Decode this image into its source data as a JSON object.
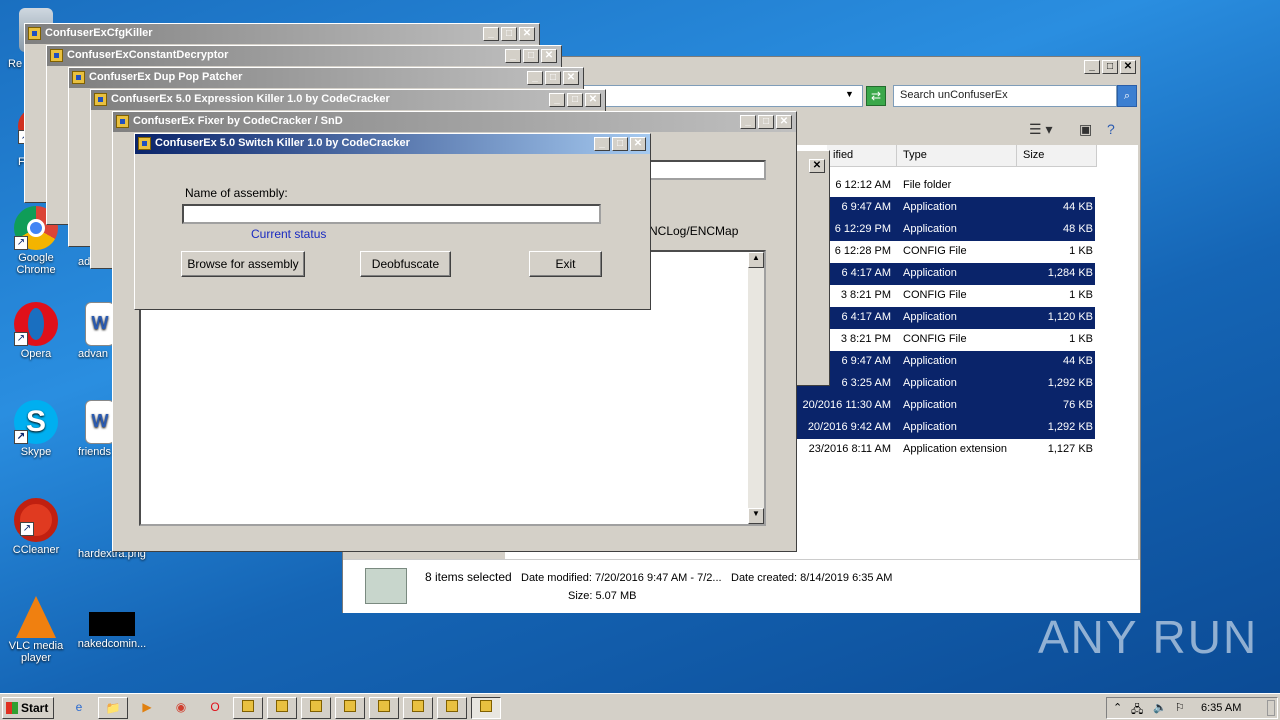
{
  "desktop": {
    "icons": [
      {
        "label": "Re",
        "name": "recycle-bin"
      },
      {
        "label": "F",
        "name": "unknown-app"
      },
      {
        "label": "Google Chrome",
        "name": "google-chrome"
      },
      {
        "label": "Opera",
        "name": "opera"
      },
      {
        "label": "Skype",
        "name": "skype"
      },
      {
        "label": "CCleaner",
        "name": "ccleaner"
      },
      {
        "label": "VLC media player",
        "name": "vlc-media-player"
      },
      {
        "label": "ad",
        "name": "ad-doc"
      },
      {
        "label": "advan",
        "name": "advance-doc"
      },
      {
        "label": "friends",
        "name": "friends-doc"
      },
      {
        "label": "hardextra.png",
        "name": "hardextra-png"
      },
      {
        "label": "nakedcomin...",
        "name": "nakedcoming"
      }
    ]
  },
  "explorer": {
    "search_placeholder": "Search unConfuserEx",
    "columns": [
      "ified",
      "Type",
      "Size"
    ],
    "rows": [
      {
        "date": "6 12:12 AM",
        "type": "File folder",
        "size": "",
        "selected": false
      },
      {
        "date": "6 9:47 AM",
        "type": "Application",
        "size": "44 KB",
        "selected": true
      },
      {
        "date": "6 12:29 PM",
        "type": "Application",
        "size": "48 KB",
        "selected": true
      },
      {
        "date": "6 12:28 PM",
        "type": "CONFIG File",
        "size": "1 KB",
        "selected": false
      },
      {
        "date": "6 4:17 AM",
        "type": "Application",
        "size": "1,284 KB",
        "selected": true
      },
      {
        "date": "3 8:21 PM",
        "type": "CONFIG File",
        "size": "1 KB",
        "selected": false
      },
      {
        "date": "6 4:17 AM",
        "type": "Application",
        "size": "1,120 KB",
        "selected": true
      },
      {
        "date": "3 8:21 PM",
        "type": "CONFIG File",
        "size": "1 KB",
        "selected": false
      },
      {
        "date": "6 9:47 AM",
        "type": "Application",
        "size": "44 KB",
        "selected": true
      },
      {
        "date": "6 3:25 AM",
        "type": "Application",
        "size": "1,292 KB",
        "selected": true
      },
      {
        "date": "20/2016 11:30 AM",
        "type": "Application",
        "size": "76 KB",
        "selected": true
      },
      {
        "date": "20/2016 9:42 AM",
        "type": "Application",
        "size": "1,292 KB",
        "selected": true
      },
      {
        "date": "23/2016 8:11 AM",
        "type": "Application extension",
        "size": "1,127 KB",
        "selected": false
      }
    ],
    "status": {
      "selected": "8 items selected",
      "modified": "Date modified: 7/20/2016 9:47 AM - 7/2...",
      "created": "Date created: 8/14/2019 6:35 AM",
      "size": "Size: 5.07 MB"
    }
  },
  "windows": {
    "cfgkiller": "ConfuserExCfgKiller",
    "constdecryptor": "ConfuserExConstantDecryptor",
    "duppop": "ConfuserEx Dup Pop Patcher",
    "exprkiller": "ConfuserEx 5.0 Expression Killer 1.0 by CodeCracker",
    "fixer": "ConfuserEx Fixer by CodeCracker / SnD",
    "fixer_label": "NCLog/ENCMap",
    "switchkiller": {
      "title": "ConfuserEx 5.0 Switch Killer 1.0 by CodeCracker",
      "name_label": "Name of assembly:",
      "current_status": "Current status",
      "browse": "Browse for assembly",
      "deobfuscate": "Deobfuscate",
      "exit": "Exit"
    }
  },
  "taskbar": {
    "start": "Start",
    "time": "6:35 AM"
  },
  "watermark": "ANY RUN"
}
